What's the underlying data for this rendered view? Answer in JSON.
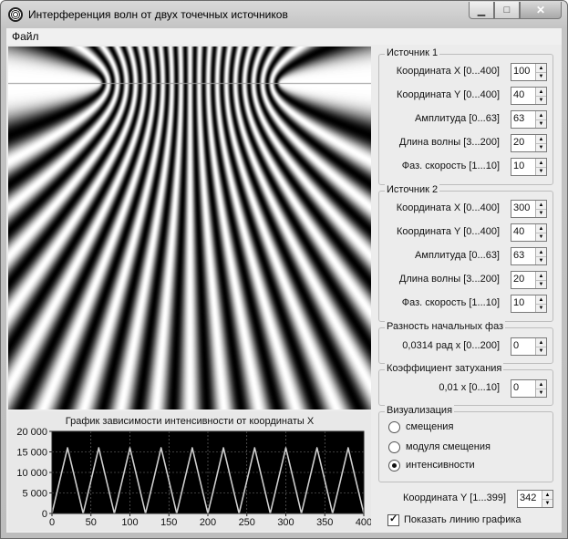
{
  "window": {
    "title": "Интерференция волн от двух точечных источников",
    "min_glyph": "▁",
    "max_glyph": "□",
    "close_glyph": "✕"
  },
  "menu": {
    "file": "Файл"
  },
  "source1": {
    "title": "Источник 1",
    "x_label": "Координата X [0...400]",
    "x_value": "100",
    "y_label": "Координата Y [0...400]",
    "y_value": "40",
    "amp_label": "Амплитуда [0...63]",
    "amp_value": "63",
    "wave_label": "Длина волны [3...200]",
    "wave_value": "20",
    "speed_label": "Фаз. скорость [1...10]",
    "speed_value": "10"
  },
  "source2": {
    "title": "Источник 2",
    "x_label": "Координата X [0...400]",
    "x_value": "300",
    "y_label": "Координата Y [0...400]",
    "y_value": "40",
    "amp_label": "Амплитуда [0...63]",
    "amp_value": "63",
    "wave_label": "Длина волны [3...200]",
    "wave_value": "20",
    "speed_label": "Фаз. скорость [1...10]",
    "speed_value": "10"
  },
  "phase_diff": {
    "title": "Разность начальных фаз",
    "label": "0,0314 рад  x  [0...200]",
    "value": "0"
  },
  "damping": {
    "title": "Коэффициент затухания",
    "label": "0,01  x  [0...10]",
    "value": "0"
  },
  "visualization": {
    "title": "Визуализация",
    "options": [
      "смещения",
      "модуля смещения",
      "интенсивности"
    ],
    "selected": 2
  },
  "line_y": {
    "label": "Координата Y [1...399]",
    "value": "342"
  },
  "show_line": {
    "label": "Показать линию графика",
    "checked": true
  },
  "line_position_y": 40,
  "chart_data": {
    "type": "line",
    "title": "График зависимости интенсивности от координаты X",
    "xlim": [
      0,
      400
    ],
    "ylim": [
      0,
      20000
    ],
    "x_ticks": [
      0,
      50,
      100,
      150,
      200,
      250,
      300,
      350,
      400
    ],
    "y_ticks": [
      0,
      5000,
      10000,
      15000,
      20000
    ],
    "y_tick_labels": [
      "0",
      "5 000",
      "10 000",
      "15 000",
      "20 000"
    ],
    "x": [
      0,
      10,
      20,
      30,
      40,
      50,
      60,
      70,
      80,
      90,
      100,
      110,
      120,
      130,
      140,
      150,
      160,
      170,
      180,
      190,
      200,
      210,
      220,
      230,
      240,
      250,
      260,
      270,
      280,
      290,
      300,
      310,
      320,
      330,
      340,
      350,
      360,
      370,
      380,
      390,
      400
    ],
    "y": [
      0,
      8000,
      16000,
      8000,
      0,
      8000,
      16000,
      8000,
      0,
      8000,
      16000,
      8000,
      0,
      8000,
      16000,
      8000,
      0,
      8000,
      16000,
      8000,
      0,
      8000,
      16000,
      8000,
      0,
      8000,
      16000,
      8000,
      0,
      8000,
      16000,
      8000,
      0,
      8000,
      16000,
      8000,
      0,
      8000,
      16000,
      8000,
      0
    ],
    "background": "#000000",
    "line_color": "#cfcfcf",
    "grid_color": "#7a7a7a"
  }
}
